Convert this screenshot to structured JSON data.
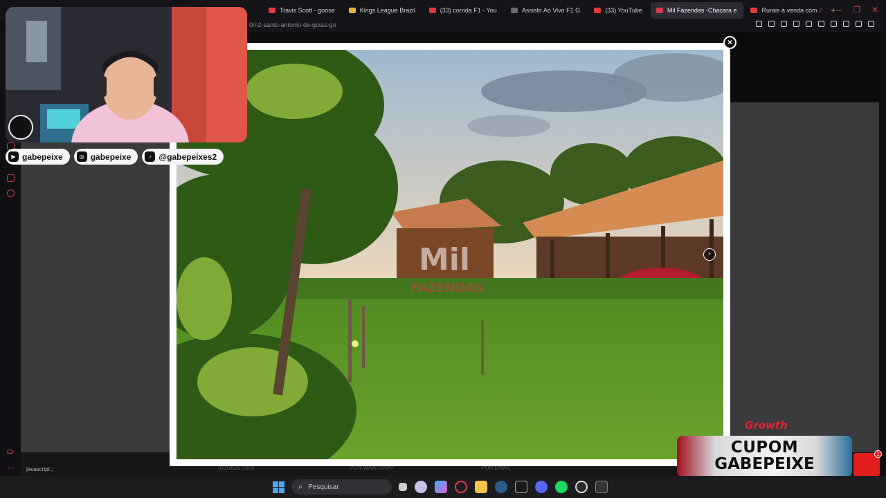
{
  "browser": {
    "tabs": [
      {
        "label": "Travis Scott - goose",
        "color": "#e23b3b"
      },
      {
        "label": "Kings League Brazil",
        "color": "#e5b53a"
      },
      {
        "label": "(33) corrida F1 - You",
        "color": "#e23b3b"
      },
      {
        "label": "Assistir Ao Vivo F1 G",
        "color": "#666a75"
      },
      {
        "label": "(33) YouTube",
        "color": "#e23b3b"
      },
      {
        "label": "Mil Fazendas -Chacara e",
        "color": "#d23a4b",
        "active": true
      },
      {
        "label": "Rurais à venda com",
        "color": "#e23b3b"
      }
    ],
    "new_tab": "+",
    "url": "0m2-santo-antonio-de-goias-go"
  },
  "lightbox": {
    "close_label": "×",
    "next_label": "›",
    "watermark_line1": "Mil",
    "watermark_line2": "FAZENDAS"
  },
  "page": {
    "under_lightbox_text": [
      "(62)3626-1000",
      "POR WHATSAPP",
      "POR EMAIL"
    ],
    "status_text": "javascript:;"
  },
  "stream_overlay": {
    "socials": [
      {
        "icon": "youtube-icon",
        "label": "gabepeixe"
      },
      {
        "icon": "instagram-icon",
        "label": "gabepeixe"
      },
      {
        "icon": "tiktok-icon",
        "label": "@gabepeixes2"
      }
    ],
    "sponsor": "Growth",
    "coupon_line1": "CUPOM",
    "coupon_line2": "GABEPEIXE",
    "notification_count": "1"
  },
  "taskbar": {
    "search_placeholder": "Pesquisar"
  }
}
